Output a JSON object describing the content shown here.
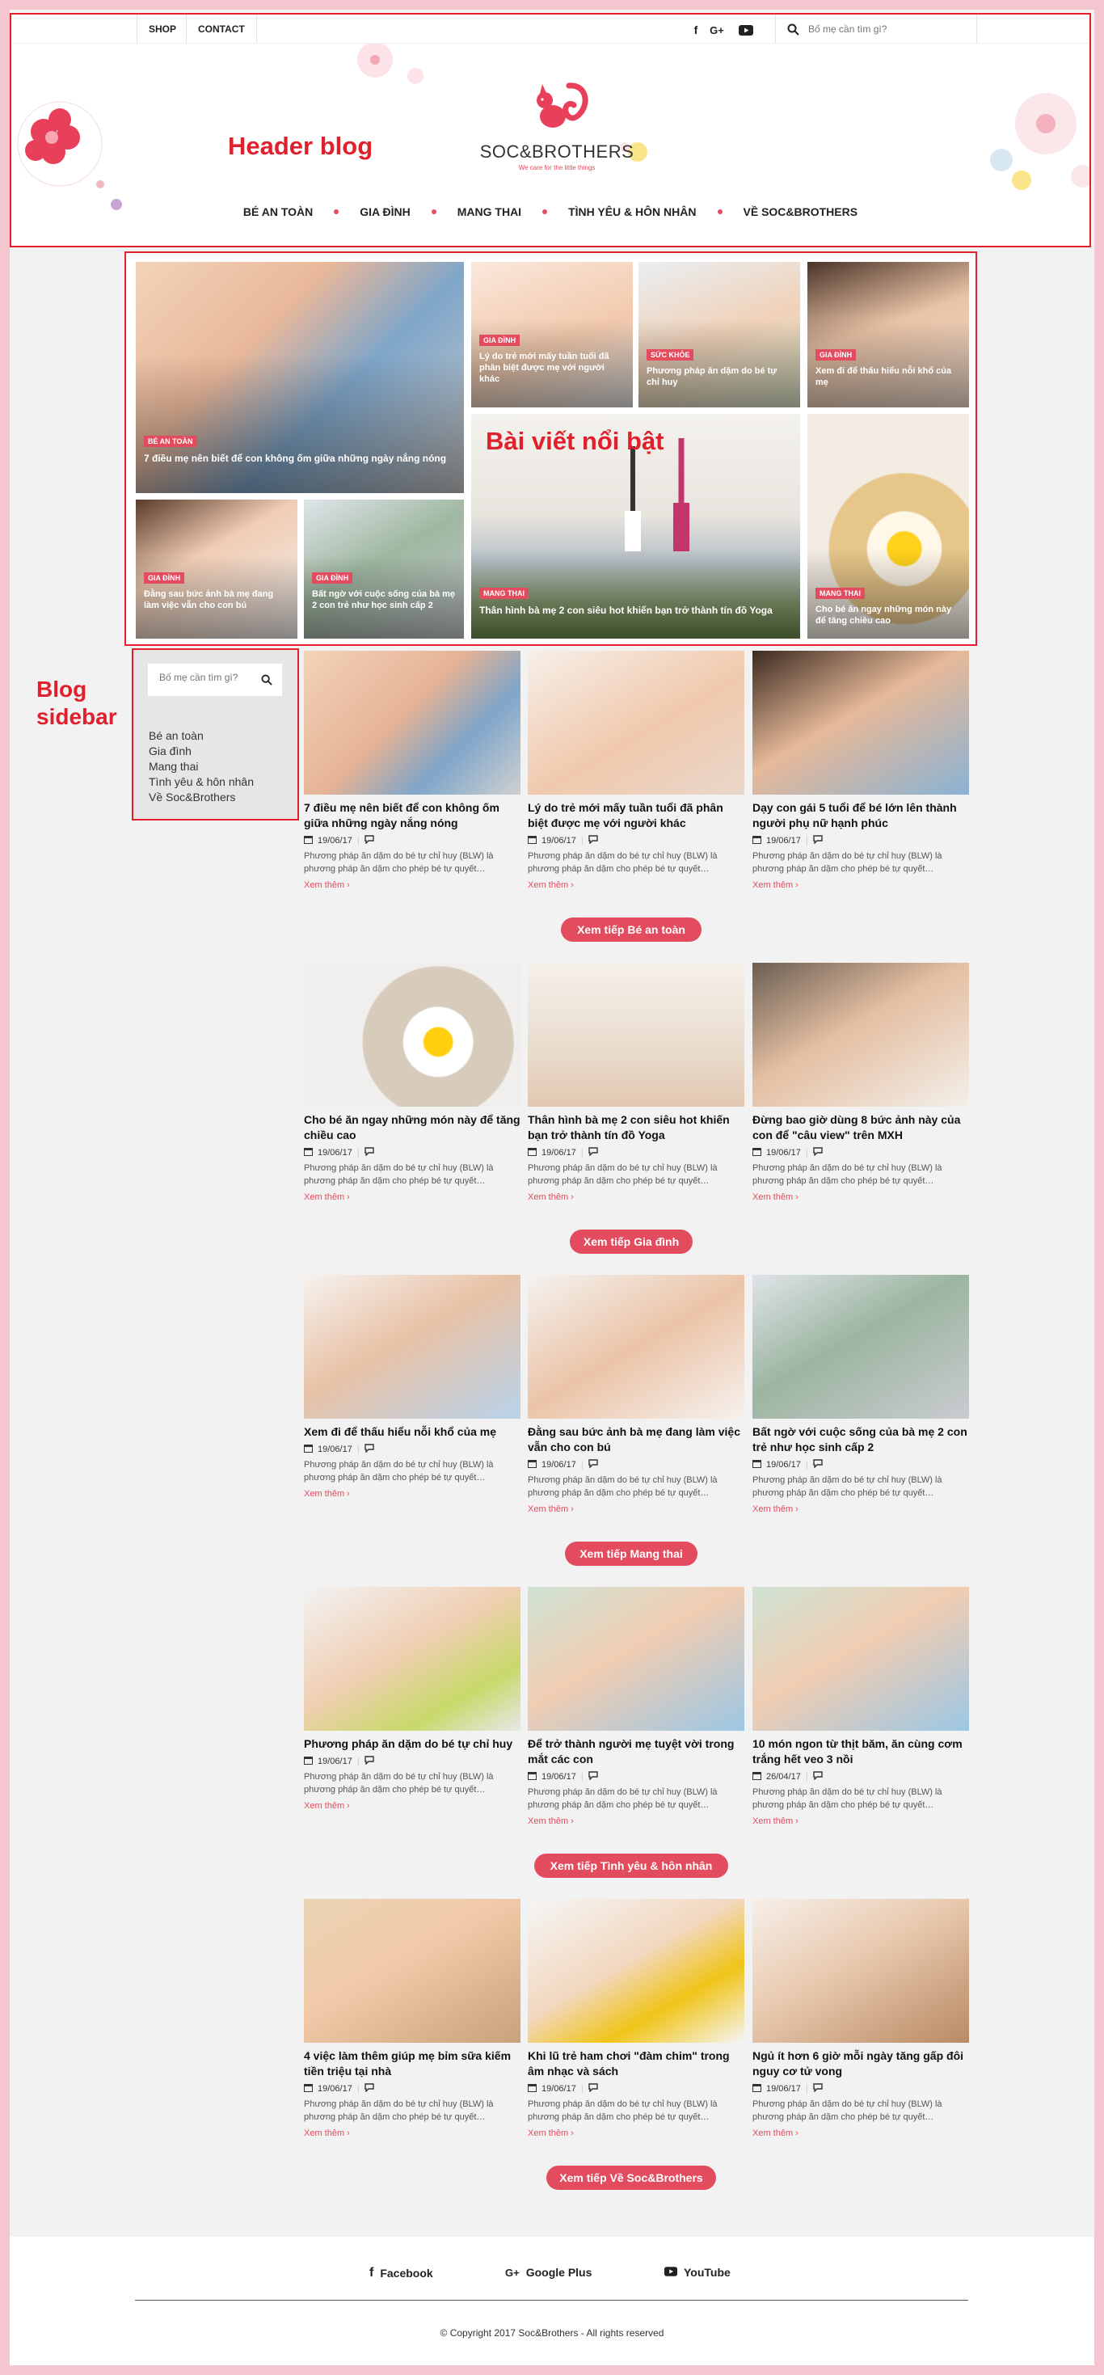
{
  "header": {
    "top_links": [
      "SHOP",
      "CONTACT"
    ],
    "search_placeholder": "Bố mẹ cần tìm gì?",
    "logo_name": "SOC&BROTHERS",
    "logo_tagline": "We care for the little things",
    "annotation_label": "Header blog",
    "nav": [
      "BÉ AN TOÀN",
      "GIA ĐÌNH",
      "MANG THAI",
      "TÌNH YÊU & HÔN NHÂN",
      "VỀ SOC&BROTHERS"
    ]
  },
  "featured": {
    "annotation_label": "Bài viết nổi bật",
    "tiles": [
      {
        "badge": "BÉ AN TOÀN",
        "title": "7 điều mẹ nên biết để con không ốm giữa những ngày nắng nóng"
      },
      {
        "badge": "GIA ĐÌNH",
        "title": "Lý do trẻ mới mấy tuần tuổi đã phân biệt được mẹ với người khác"
      },
      {
        "badge": "SỨC KHỎE",
        "title": "Phương pháp ăn dặm do bé tự chỉ huy"
      },
      {
        "badge": "GIA ĐÌNH",
        "title": "Xem đi để thấu hiểu nỗi khổ của mẹ"
      },
      {
        "badge": "GIA ĐÌNH",
        "title": "Đằng sau bức ảnh bà mẹ đang làm việc vẫn cho con bú"
      },
      {
        "badge": "GIA ĐÌNH",
        "title": "Bất ngờ với cuộc sống của bà mẹ 2 con trẻ như học sinh cấp 2"
      },
      {
        "badge": "MANG THAI",
        "title": "Thân hình bà mẹ 2 con siêu hot khiến bạn trở thành tín đồ Yoga"
      },
      {
        "badge": "MANG THAI",
        "title": "Cho bé ăn ngay những món này để tăng chiều cao"
      }
    ]
  },
  "sidebar": {
    "annotation_label_1": "Blog",
    "annotation_label_2": "sidebar",
    "search_placeholder": "Bố mẹ cần tìm gì?",
    "categories": [
      "Bé an toàn",
      "Gia đình",
      "Mang thai",
      "Tình yêu & hôn nhân",
      "Về Soc&Brothers"
    ]
  },
  "post_meta": {
    "excerpt": "Phương pháp ăn dặm do bé tự chỉ huy (BLW) là phương pháp ăn dặm cho phép bé tự quyết…",
    "read_more": "Xem thêm ›"
  },
  "sections": [
    {
      "more_label": "Xem tiếp Bé an toàn",
      "posts": [
        {
          "title": "7 điều mẹ nên biết để con không ốm giữa những ngày nắng nóng",
          "date": "19/06/17"
        },
        {
          "title": "Lý do trẻ mới mấy tuần tuổi đã phân biệt được mẹ với người khác",
          "date": "19/06/17"
        },
        {
          "title": "Dạy con gái 5 tuổi để bé lớn lên thành người phụ nữ hạnh phúc",
          "date": "19/06/17"
        }
      ]
    },
    {
      "more_label": "Xem tiếp Gia đình",
      "posts": [
        {
          "title": "Cho bé ăn ngay những món này để tăng chiều cao",
          "date": "19/06/17"
        },
        {
          "title": "Thân hình bà mẹ 2 con siêu hot khiến bạn trở thành tín đồ Yoga",
          "date": "19/06/17"
        },
        {
          "title": "Đừng bao giờ dùng 8 bức ảnh này của con để \"câu view\" trên MXH",
          "date": "19/06/17"
        }
      ]
    },
    {
      "more_label": "Xem tiếp Mang thai",
      "posts": [
        {
          "title": "Xem đi để thấu hiểu nỗi khổ của mẹ",
          "date": "19/06/17"
        },
        {
          "title": "Đằng sau bức ảnh bà mẹ đang làm việc vẫn cho con bú",
          "date": "19/06/17"
        },
        {
          "title": "Bất ngờ với cuộc sống của bà mẹ 2 con trẻ như học sinh cấp 2",
          "date": "19/06/17"
        }
      ]
    },
    {
      "more_label": "Xem tiếp Tình yêu & hôn nhân",
      "posts": [
        {
          "title": "Phương pháp ăn dặm do bé tự chỉ huy",
          "date": "19/06/17"
        },
        {
          "title": "Để trở thành người mẹ tuyệt vời trong mắt các con",
          "date": "19/06/17"
        },
        {
          "title": "10 món ngon từ thịt băm, ăn cùng cơm trắng hết veo 3 nồi",
          "date": "26/04/17"
        }
      ]
    },
    {
      "more_label": "Xem tiếp Về Soc&Brothers",
      "posts": [
        {
          "title": "4 việc làm thêm giúp mẹ bỉm sữa kiếm tiền triệu tại nhà",
          "date": "19/06/17"
        },
        {
          "title": "Khi lũ trẻ ham chơi \"đàm chim\" trong âm nhạc và sách",
          "date": "19/06/17"
        },
        {
          "title": "Ngủ ít hơn 6 giờ mỗi ngày tăng gấp đôi nguy cơ tử vong",
          "date": "19/06/17"
        }
      ]
    }
  ],
  "footer": {
    "links": [
      "Facebook",
      "Google Plus",
      "YouTube"
    ],
    "copyright": "© Copyright 2017 Soc&Brothers - All rights reserved"
  },
  "colors": {
    "accent": "#e34b5e",
    "annotation": "#e0202c",
    "page_border": "#f3c6d0"
  }
}
